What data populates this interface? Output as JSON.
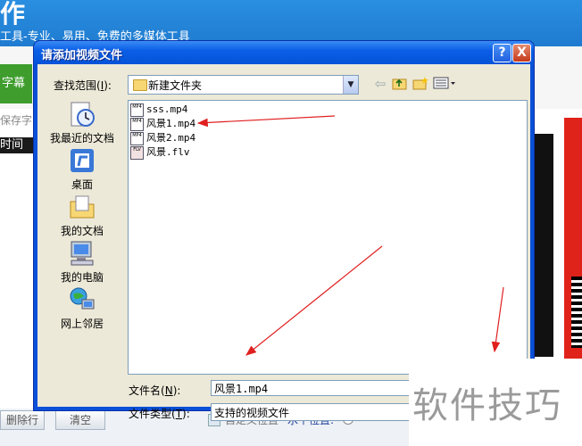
{
  "app": {
    "title_fragment": "作",
    "slogan": "工具-专业、易用、免费的多媒体工具",
    "subtitle_tab": "字幕",
    "save_label": "保存字",
    "list_header": "时间",
    "bottom": {
      "delete_row": "删除行",
      "clear": "清空",
      "custom_position": "自定义位置",
      "horizontal_position": "水平位置:"
    }
  },
  "dialog": {
    "title": "请添加视频文件",
    "help_glyph": "?",
    "close_glyph": "X",
    "look_in_label": "查找范围",
    "look_in_key": "I",
    "look_in_value": "新建文件夹",
    "places": [
      {
        "label": "我最近的文档",
        "icon": "recent-documents-icon"
      },
      {
        "label": "桌面",
        "icon": "desktop-icon"
      },
      {
        "label": "我的文档",
        "icon": "my-documents-icon"
      },
      {
        "label": "我的电脑",
        "icon": "my-computer-icon"
      },
      {
        "label": "网上邻居",
        "icon": "network-places-icon"
      }
    ],
    "files": [
      {
        "name": "sss.mp4",
        "type": "MP4"
      },
      {
        "name": "风景1.mp4",
        "type": "MP4"
      },
      {
        "name": "风景2.mp4",
        "type": "MP4"
      },
      {
        "name": "风景.flv",
        "type": "FLV"
      }
    ],
    "file_name_label": "文件名",
    "file_name_key": "N",
    "file_name_value": "风景1.mp4",
    "file_type_label": "文件类型",
    "file_type_key": "T",
    "file_type_value": "支持的视频文件"
  },
  "watermark": "软件技巧",
  "colors": {
    "annotation_arrow": "#e02020",
    "titlebar_blue": "#0b5fe6"
  }
}
